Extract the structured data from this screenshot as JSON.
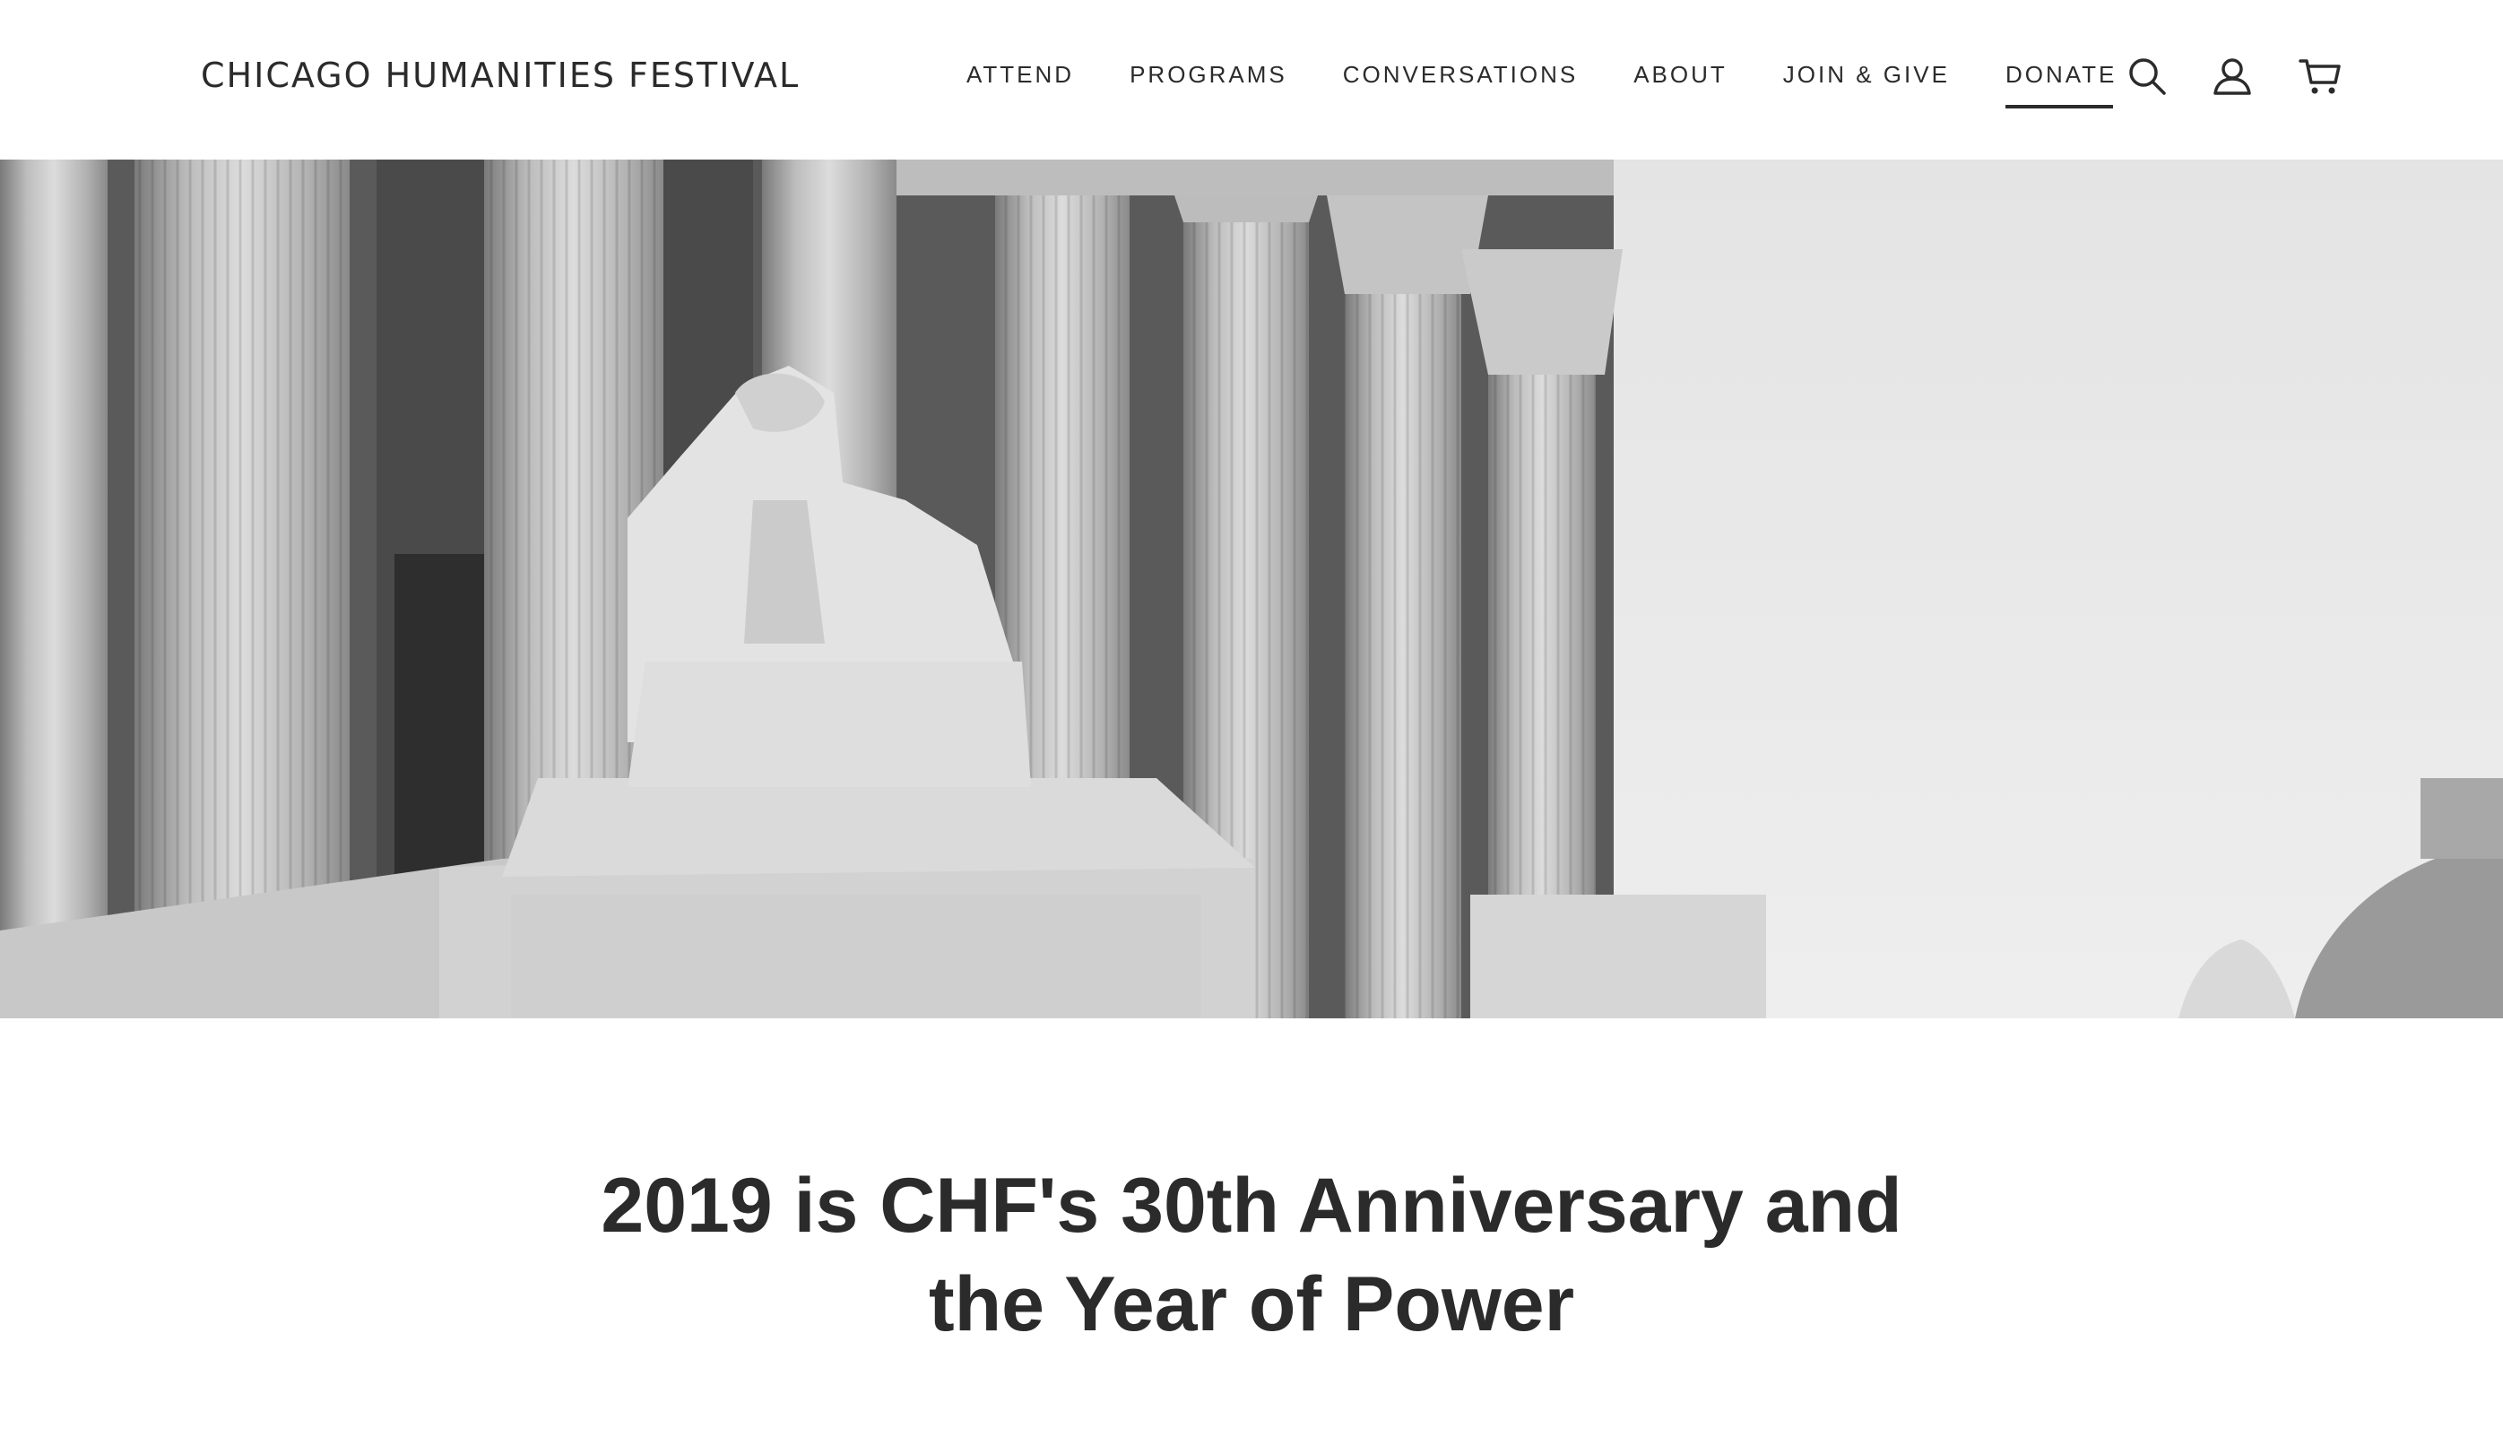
{
  "header": {
    "logo": "CHICAGO HUMANITIES FESTIVAL",
    "nav": [
      {
        "label": "ATTEND"
      },
      {
        "label": "PROGRAMS"
      },
      {
        "label": "CONVERSATIONS"
      },
      {
        "label": "ABOUT"
      },
      {
        "label": "JOIN & GIVE"
      },
      {
        "label": "DONATE",
        "active": true
      }
    ],
    "icons": [
      "search-icon",
      "account-icon",
      "cart-icon"
    ]
  },
  "hero": {
    "image": "grayscale photo of a marble statue seated before fluted columns of a neoclassical building with a domed building at right"
  },
  "main": {
    "headline": "2019 is CHF's 30th Anniversary and the Year of Power"
  },
  "colors": {
    "text": "#2b2b2b",
    "background": "#ffffff"
  }
}
